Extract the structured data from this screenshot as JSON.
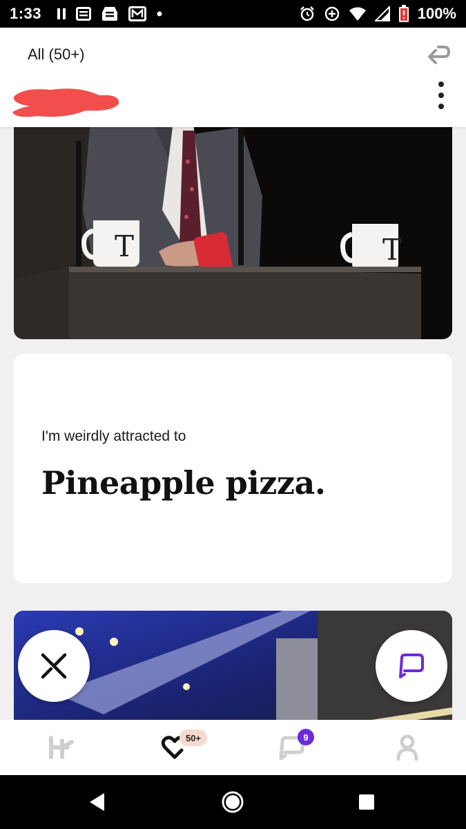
{
  "status_bar": {
    "time": "1:33",
    "battery_percent": "100%",
    "left_icons": [
      "pause-icon",
      "news-icon",
      "inbox-icon",
      "gmail-icon",
      "dot-icon"
    ],
    "right_icons": [
      "alarm-icon",
      "data-saver-icon",
      "wifi-icon",
      "signal-icon",
      "battery-icon"
    ]
  },
  "header": {
    "filter_label": "All (50+)",
    "undo_icon": "undo-arrow-icon",
    "more_icon": "more-vertical-icon",
    "redacted_name": "redacted"
  },
  "feed": {
    "photo_1": {
      "description_icon": "photo"
    },
    "prompt": {
      "question": "I'm weirdly attracted to",
      "answer": "Pineapple pizza."
    },
    "photo_2": {
      "description_icon": "photo"
    }
  },
  "actions": {
    "skip_icon": "close-x-icon",
    "comment_icon": "comment-bubble-icon"
  },
  "tab_bar": {
    "tabs": [
      {
        "name": "home",
        "icon": "hinge-logo-icon"
      },
      {
        "name": "likes",
        "icon": "heart-icon",
        "badge": "50+"
      },
      {
        "name": "matches",
        "icon": "chat-bubble-icon",
        "badge": "9"
      },
      {
        "name": "profile",
        "icon": "person-icon"
      }
    ]
  },
  "colors": {
    "accent_purple": "#6c2bd9",
    "likes_badge": "#f7d9cf",
    "redaction": "#f24e4e",
    "inactive_icon": "#cfcfcf"
  }
}
